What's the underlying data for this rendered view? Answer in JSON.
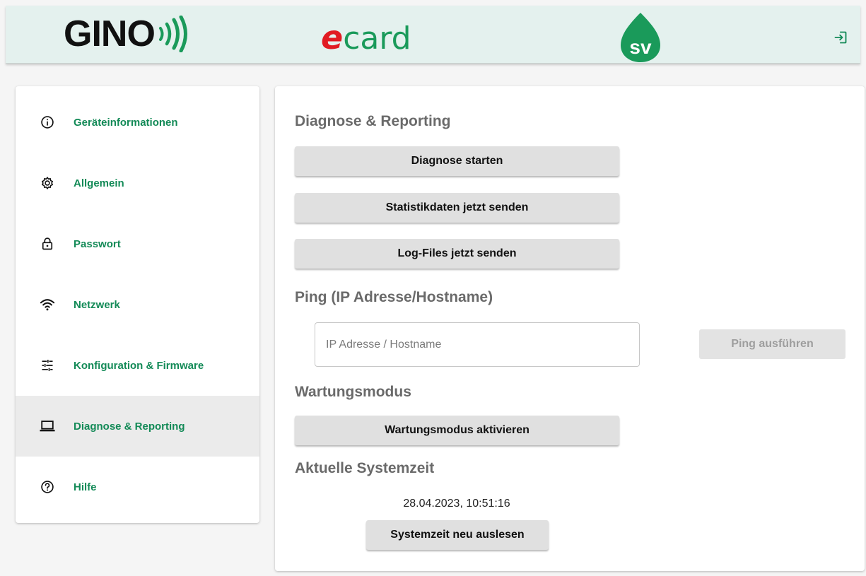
{
  "header": {
    "gino_logo_text": "GINO",
    "ecard_logo_e": "e",
    "ecard_logo_rest": "card",
    "sv_logo_text": "sv",
    "logout_icon": "logout-icon"
  },
  "sidebar": {
    "items": [
      {
        "label": "Geräteinformationen",
        "icon": "info-icon"
      },
      {
        "label": "Allgemein",
        "icon": "gear-icon"
      },
      {
        "label": "Passwort",
        "icon": "lock-icon"
      },
      {
        "label": "Netzwerk",
        "icon": "wifi-icon"
      },
      {
        "label": "Konfiguration & Firmware",
        "icon": "tune-icon"
      },
      {
        "label": "Diagnose & Reporting",
        "icon": "laptop-icon",
        "active": true
      },
      {
        "label": "Hilfe",
        "icon": "help-icon"
      }
    ]
  },
  "main": {
    "diagnose": {
      "title": "Diagnose & Reporting",
      "start_label": "Diagnose starten",
      "stats_label": "Statistikdaten jetzt senden",
      "logs_label": "Log-Files jetzt senden"
    },
    "ping": {
      "title": "Ping (IP Adresse/Hostname)",
      "placeholder": "IP Adresse / Hostname",
      "value": "",
      "button_label": "Ping ausführen"
    },
    "wartung": {
      "title": "Wartungsmodus",
      "button_label": "Wartungsmodus aktivieren"
    },
    "systemzeit": {
      "title": "Aktuelle Systemzeit",
      "value": "28.04.2023, 10:51:16",
      "button_label": "Systemzeit neu auslesen"
    }
  },
  "colors": {
    "brand_green": "#138a57",
    "header_bg": "#e4f1ee",
    "ecard_red": "#e11b22",
    "button_bg": "#e0e0e0"
  }
}
